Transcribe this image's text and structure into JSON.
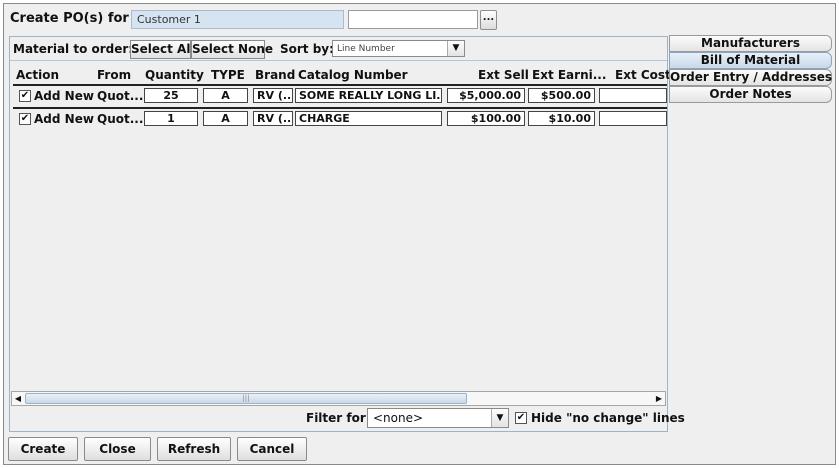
{
  "header": {
    "label": "Create PO(s) for :",
    "customer_value": "Customer 1",
    "secondary_value": "",
    "browse_label": "..."
  },
  "toolbar": {
    "material_label": "Material to order:",
    "select_all": "Select All",
    "select_none": "Select None",
    "sort_label": "Sort by:",
    "sort_value": "Line Number"
  },
  "columns": [
    "Action",
    "From",
    "Quantity",
    "TYPE",
    "Brand",
    "Catalog Number",
    "Ext Sell",
    "Ext Earni...",
    "Ext Cost"
  ],
  "rows": [
    {
      "checked": true,
      "action": "Add New",
      "from": "Quot...",
      "quantity": "25",
      "type": "A",
      "brand": "RV (...",
      "catalog": "SOME REALLY LONG LI...",
      "ext_sell": "$5,000.00",
      "ext_earnings": "$500.00",
      "ext_cost": ""
    },
    {
      "checked": true,
      "action": "Add New",
      "from": "Quot...",
      "quantity": "1",
      "type": "A",
      "brand": "RV (...",
      "catalog": "CHARGE",
      "ext_sell": "$100.00",
      "ext_earnings": "$10.00",
      "ext_cost": ""
    }
  ],
  "filter": {
    "label": "Filter for:",
    "value": "<none>",
    "hide_checked": true,
    "hide_label": "Hide \"no change\" lines"
  },
  "tabs": [
    {
      "label": "Manufacturers",
      "active": false
    },
    {
      "label": "Bill of Material",
      "active": true
    },
    {
      "label": "Order Entry / Addresses",
      "active": false
    },
    {
      "label": "Order Notes",
      "active": false
    }
  ],
  "buttons": {
    "create": "Create",
    "close": "Close",
    "refresh": "Refresh",
    "cancel": "Cancel"
  },
  "icons": {
    "checkbox": "checkmark-icon",
    "combo_arrow": "triangle-down-icon",
    "scroll_left": "arrow-left-icon",
    "scroll_right": "arrow-right-icon"
  },
  "colors": {
    "customer_field_bg": "#d6e4f1",
    "active_tab_bg": "#c8d8e9"
  }
}
